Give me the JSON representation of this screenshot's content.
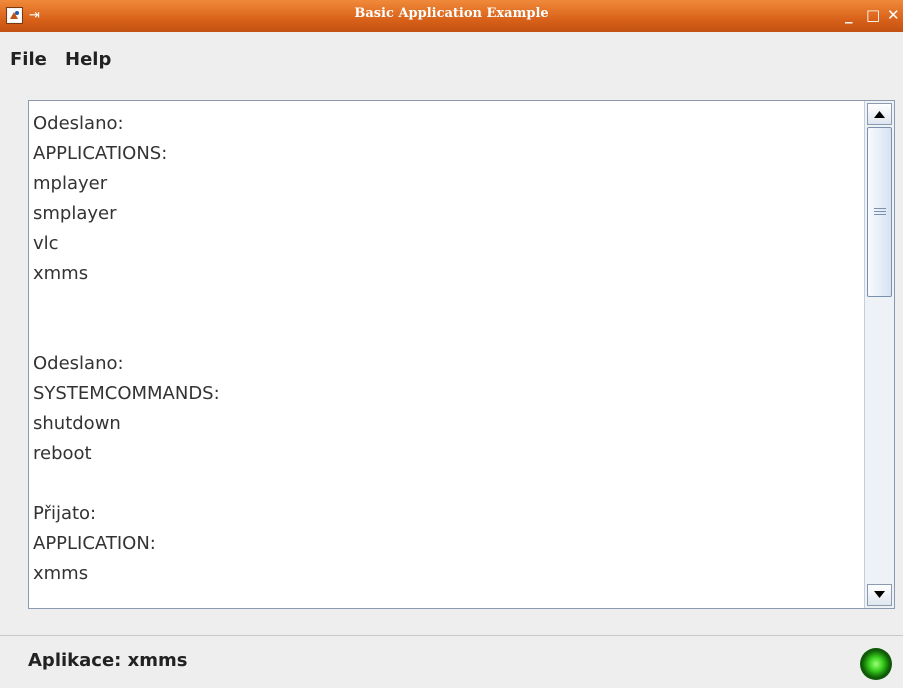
{
  "window": {
    "title": "Basic Application Example",
    "icons": [
      "app-icon",
      "pin-icon",
      "minimize-icon",
      "maximize-icon",
      "close-icon"
    ],
    "minimize_glyph": "_",
    "maximize_glyph": "□",
    "close_glyph": "✕"
  },
  "menu": {
    "items": [
      {
        "label": "File"
      },
      {
        "label": "Help"
      }
    ]
  },
  "content": {
    "lines": [
      "Odeslano:",
      "APPLICATIONS:",
      "mplayer",
      "smplayer",
      "vlc",
      "xmms",
      "",
      "",
      "Odeslano:",
      "SYSTEMCOMMANDS:",
      "shutdown",
      "reboot",
      "",
      "Přijato:",
      "APPLICATION:",
      "xmms"
    ],
    "scrollbar_position": 0.0
  },
  "status": {
    "text": "Aplikace: xmms",
    "indicator_color": "#3ad11f"
  },
  "colors": {
    "titlebar": "#d9621a",
    "background": "#eeeeee"
  }
}
